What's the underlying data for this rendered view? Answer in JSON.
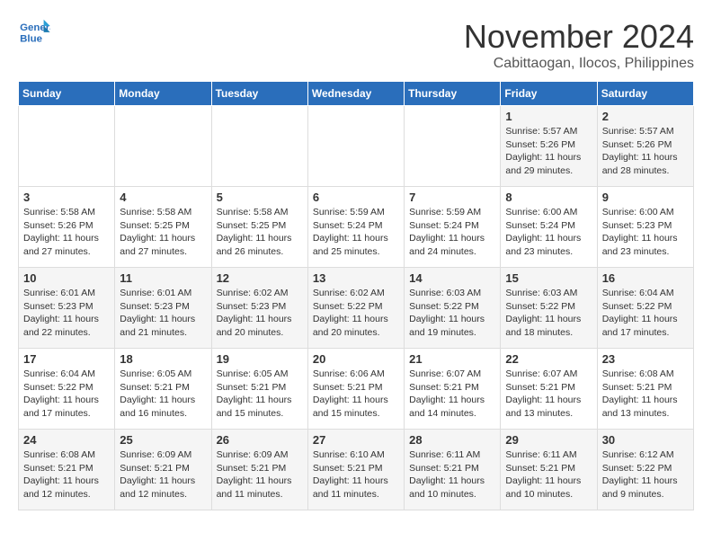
{
  "header": {
    "logo_line1": "General",
    "logo_line2": "Blue",
    "month": "November 2024",
    "location": "Cabittaogan, Ilocos, Philippines"
  },
  "weekdays": [
    "Sunday",
    "Monday",
    "Tuesday",
    "Wednesday",
    "Thursday",
    "Friday",
    "Saturday"
  ],
  "weeks": [
    [
      {
        "day": "",
        "info": ""
      },
      {
        "day": "",
        "info": ""
      },
      {
        "day": "",
        "info": ""
      },
      {
        "day": "",
        "info": ""
      },
      {
        "day": "",
        "info": ""
      },
      {
        "day": "1",
        "info": "Sunrise: 5:57 AM\nSunset: 5:26 PM\nDaylight: 11 hours and 29 minutes."
      },
      {
        "day": "2",
        "info": "Sunrise: 5:57 AM\nSunset: 5:26 PM\nDaylight: 11 hours and 28 minutes."
      }
    ],
    [
      {
        "day": "3",
        "info": "Sunrise: 5:58 AM\nSunset: 5:26 PM\nDaylight: 11 hours and 27 minutes."
      },
      {
        "day": "4",
        "info": "Sunrise: 5:58 AM\nSunset: 5:25 PM\nDaylight: 11 hours and 27 minutes."
      },
      {
        "day": "5",
        "info": "Sunrise: 5:58 AM\nSunset: 5:25 PM\nDaylight: 11 hours and 26 minutes."
      },
      {
        "day": "6",
        "info": "Sunrise: 5:59 AM\nSunset: 5:24 PM\nDaylight: 11 hours and 25 minutes."
      },
      {
        "day": "7",
        "info": "Sunrise: 5:59 AM\nSunset: 5:24 PM\nDaylight: 11 hours and 24 minutes."
      },
      {
        "day": "8",
        "info": "Sunrise: 6:00 AM\nSunset: 5:24 PM\nDaylight: 11 hours and 23 minutes."
      },
      {
        "day": "9",
        "info": "Sunrise: 6:00 AM\nSunset: 5:23 PM\nDaylight: 11 hours and 23 minutes."
      }
    ],
    [
      {
        "day": "10",
        "info": "Sunrise: 6:01 AM\nSunset: 5:23 PM\nDaylight: 11 hours and 22 minutes."
      },
      {
        "day": "11",
        "info": "Sunrise: 6:01 AM\nSunset: 5:23 PM\nDaylight: 11 hours and 21 minutes."
      },
      {
        "day": "12",
        "info": "Sunrise: 6:02 AM\nSunset: 5:23 PM\nDaylight: 11 hours and 20 minutes."
      },
      {
        "day": "13",
        "info": "Sunrise: 6:02 AM\nSunset: 5:22 PM\nDaylight: 11 hours and 20 minutes."
      },
      {
        "day": "14",
        "info": "Sunrise: 6:03 AM\nSunset: 5:22 PM\nDaylight: 11 hours and 19 minutes."
      },
      {
        "day": "15",
        "info": "Sunrise: 6:03 AM\nSunset: 5:22 PM\nDaylight: 11 hours and 18 minutes."
      },
      {
        "day": "16",
        "info": "Sunrise: 6:04 AM\nSunset: 5:22 PM\nDaylight: 11 hours and 17 minutes."
      }
    ],
    [
      {
        "day": "17",
        "info": "Sunrise: 6:04 AM\nSunset: 5:22 PM\nDaylight: 11 hours and 17 minutes."
      },
      {
        "day": "18",
        "info": "Sunrise: 6:05 AM\nSunset: 5:21 PM\nDaylight: 11 hours and 16 minutes."
      },
      {
        "day": "19",
        "info": "Sunrise: 6:05 AM\nSunset: 5:21 PM\nDaylight: 11 hours and 15 minutes."
      },
      {
        "day": "20",
        "info": "Sunrise: 6:06 AM\nSunset: 5:21 PM\nDaylight: 11 hours and 15 minutes."
      },
      {
        "day": "21",
        "info": "Sunrise: 6:07 AM\nSunset: 5:21 PM\nDaylight: 11 hours and 14 minutes."
      },
      {
        "day": "22",
        "info": "Sunrise: 6:07 AM\nSunset: 5:21 PM\nDaylight: 11 hours and 13 minutes."
      },
      {
        "day": "23",
        "info": "Sunrise: 6:08 AM\nSunset: 5:21 PM\nDaylight: 11 hours and 13 minutes."
      }
    ],
    [
      {
        "day": "24",
        "info": "Sunrise: 6:08 AM\nSunset: 5:21 PM\nDaylight: 11 hours and 12 minutes."
      },
      {
        "day": "25",
        "info": "Sunrise: 6:09 AM\nSunset: 5:21 PM\nDaylight: 11 hours and 12 minutes."
      },
      {
        "day": "26",
        "info": "Sunrise: 6:09 AM\nSunset: 5:21 PM\nDaylight: 11 hours and 11 minutes."
      },
      {
        "day": "27",
        "info": "Sunrise: 6:10 AM\nSunset: 5:21 PM\nDaylight: 11 hours and 11 minutes."
      },
      {
        "day": "28",
        "info": "Sunrise: 6:11 AM\nSunset: 5:21 PM\nDaylight: 11 hours and 10 minutes."
      },
      {
        "day": "29",
        "info": "Sunrise: 6:11 AM\nSunset: 5:21 PM\nDaylight: 11 hours and 10 minutes."
      },
      {
        "day": "30",
        "info": "Sunrise: 6:12 AM\nSunset: 5:22 PM\nDaylight: 11 hours and 9 minutes."
      }
    ]
  ]
}
